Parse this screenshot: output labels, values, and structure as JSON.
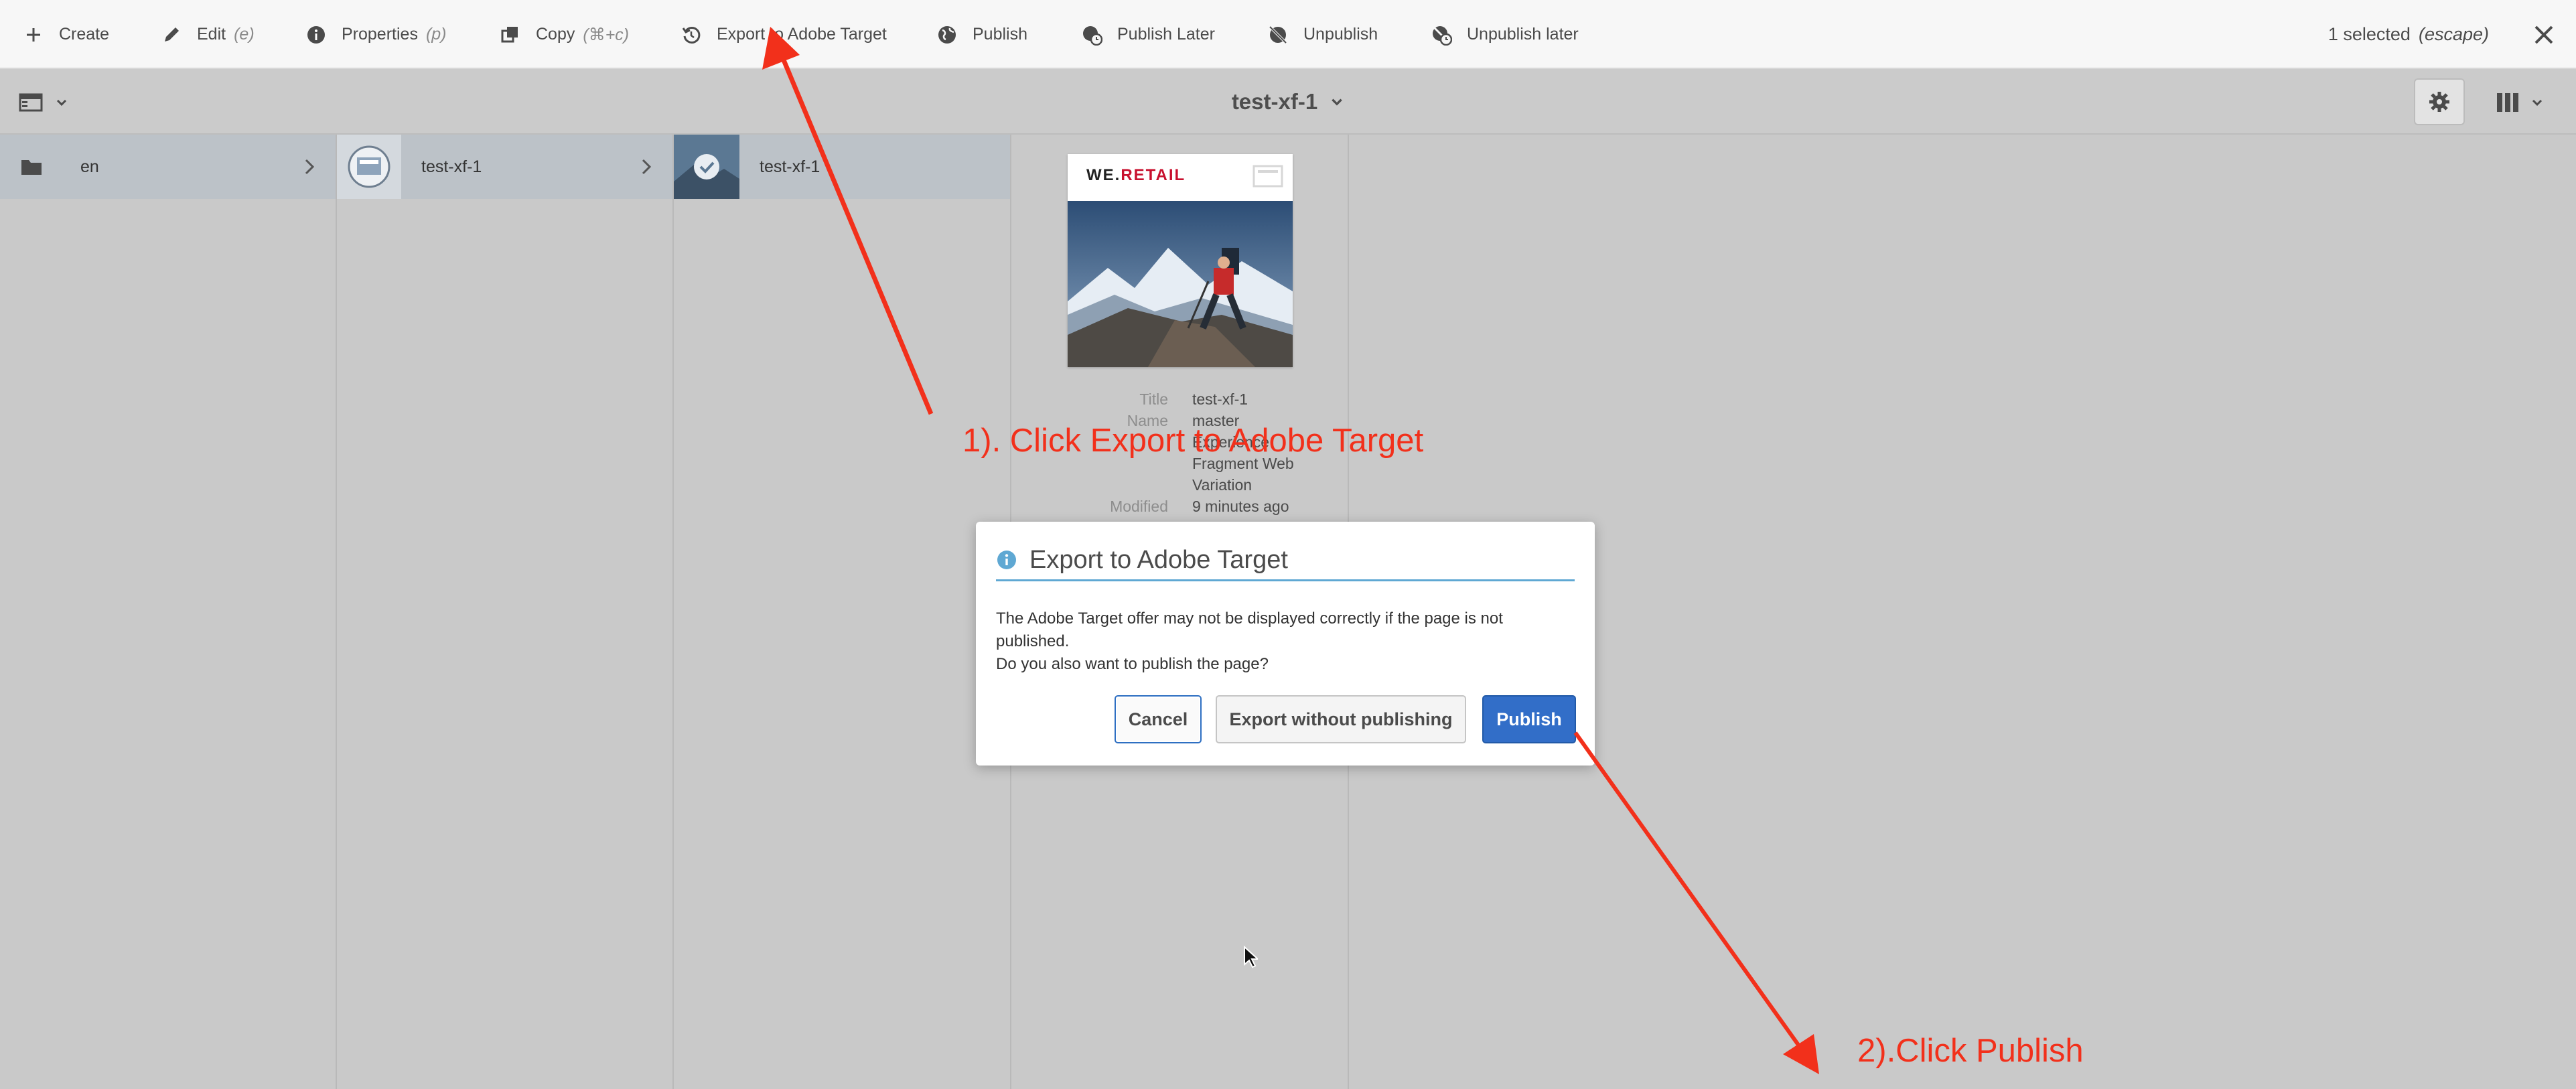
{
  "actionbar": {
    "create": "Create",
    "edit": "Edit",
    "edit_shortcut": "(e)",
    "properties": "Properties",
    "properties_shortcut": "(p)",
    "copy": "Copy",
    "copy_shortcut": "(⌘+c)",
    "export_target": "Export to Adobe Target",
    "publish": "Publish",
    "publish_later": "Publish Later",
    "unpublish": "Unpublish",
    "unpublish_later": "Unpublish later",
    "selected": "1 selected",
    "selected_hint": "(escape)"
  },
  "toolbar": {
    "title": "test-xf-1"
  },
  "columns": {
    "col1_item": "en",
    "col2_item": "test-xf-1",
    "col3_item": "test-xf-1"
  },
  "preview": {
    "brand_we": "WE.",
    "brand_retail": "RETAIL",
    "title_label": "Title",
    "title_value": "test-xf-1",
    "name_label": "Name",
    "name_value": "master",
    "template_value_1": "Experience",
    "template_value_2": "Fragment Web",
    "template_value_3": "Variation",
    "modified_label": "Modified",
    "modified_value": "9 minutes ago"
  },
  "dialog": {
    "title": "Export to Adobe Target",
    "line1": "The Adobe Target offer may not be displayed correctly if the page is not published.",
    "line2": "Do you also want to publish the page?",
    "cancel": "Cancel",
    "export_without": "Export without publishing",
    "publish": "Publish"
  },
  "annotations": {
    "step1": "1). Click Export to Adobe Target",
    "step2": "2).Click Publish",
    "color": "#f2301b"
  }
}
